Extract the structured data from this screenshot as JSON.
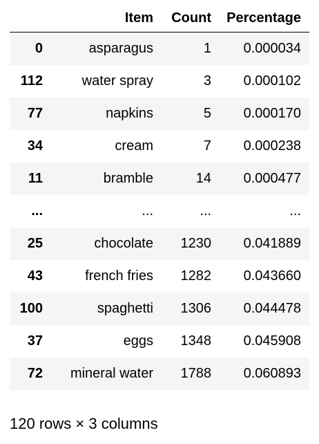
{
  "table": {
    "columns": [
      "",
      "Item",
      "Count",
      "Percentage"
    ],
    "rows": [
      [
        "0",
        "asparagus",
        "1",
        "0.000034"
      ],
      [
        "112",
        "water spray",
        "3",
        "0.000102"
      ],
      [
        "77",
        "napkins",
        "5",
        "0.000170"
      ],
      [
        "34",
        "cream",
        "7",
        "0.000238"
      ],
      [
        "11",
        "bramble",
        "14",
        "0.000477"
      ],
      [
        "...",
        "...",
        "...",
        "..."
      ],
      [
        "25",
        "chocolate",
        "1230",
        "0.041889"
      ],
      [
        "43",
        "french fries",
        "1282",
        "0.043660"
      ],
      [
        "100",
        "spaghetti",
        "1306",
        "0.044478"
      ],
      [
        "37",
        "eggs",
        "1348",
        "0.045908"
      ],
      [
        "72",
        "mineral water",
        "1788",
        "0.060893"
      ]
    ]
  },
  "footer": {
    "shape_text": "120 rows × 3 columns"
  }
}
